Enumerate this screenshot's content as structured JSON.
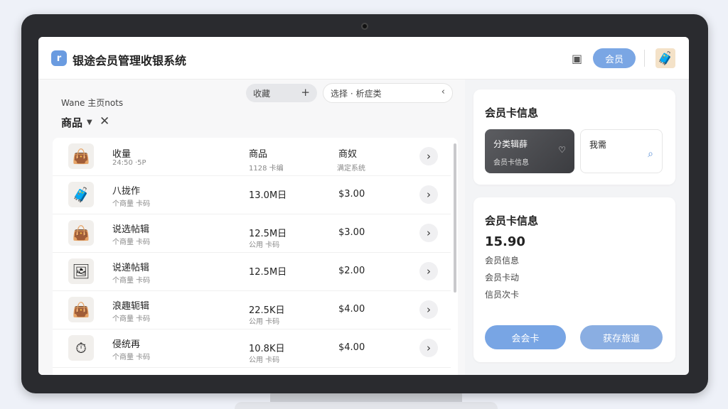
{
  "header": {
    "app_title": "银途会员管理收银系统",
    "member_button": "会员"
  },
  "left": {
    "subtitle": "Wane 主页nots",
    "category": "商品",
    "filter_chip": "收藏",
    "search_value": "选择 · 析症类"
  },
  "table": {
    "rows": [
      {
        "thumb": "👜",
        "name": "收量",
        "meta": "24:50 ·5P",
        "c2": "商品",
        "c2sub": "1128 卡编",
        "c3": "商奴",
        "c3sub": "满定系统"
      },
      {
        "thumb": "🧳",
        "name": "八拢作",
        "meta": "个商量 卡码",
        "c2": "13.0M日",
        "c2sub": "",
        "c3": "$3.00",
        "c3sub": ""
      },
      {
        "thumb": "👜",
        "name": "说选帖辑",
        "meta": "个商量 卡码",
        "c2": "12.5M日",
        "c2sub": "公用 卡码",
        "c3": "$3.00",
        "c3sub": ""
      },
      {
        "thumb": "🖼",
        "name": "说递帖辑",
        "meta": "个商量 卡码",
        "c2": "12.5M日",
        "c2sub": "",
        "c3": "$2.00",
        "c3sub": ""
      },
      {
        "thumb": "👜",
        "name": "浪趣轭辑",
        "meta": "个商量 卡码",
        "c2": "22.5K日",
        "c2sub": "公用 卡码",
        "c3": "$4.00",
        "c3sub": ""
      },
      {
        "thumb": "⏱",
        "name": "侵统再",
        "meta": "个商量 卡码",
        "c2": "10.8K日",
        "c2sub": "公用 卡码",
        "c3": "$4.00",
        "c3sub": ""
      }
    ]
  },
  "right": {
    "card1": {
      "title": "会员卡信息",
      "dark_card_title": "分类辑薛",
      "dark_card_sub": "会员卡信息",
      "light_card_title": "我需"
    },
    "card2": {
      "title": "会员卡信息",
      "amount": "15.90",
      "lines": [
        "会员信息",
        "会员卡动",
        "信员次卡"
      ],
      "primary_button": "会会卡",
      "secondary_button": "获存旅道"
    }
  },
  "colors": {
    "accent": "#78a5e4",
    "dark_card": "#4a4b4f"
  }
}
